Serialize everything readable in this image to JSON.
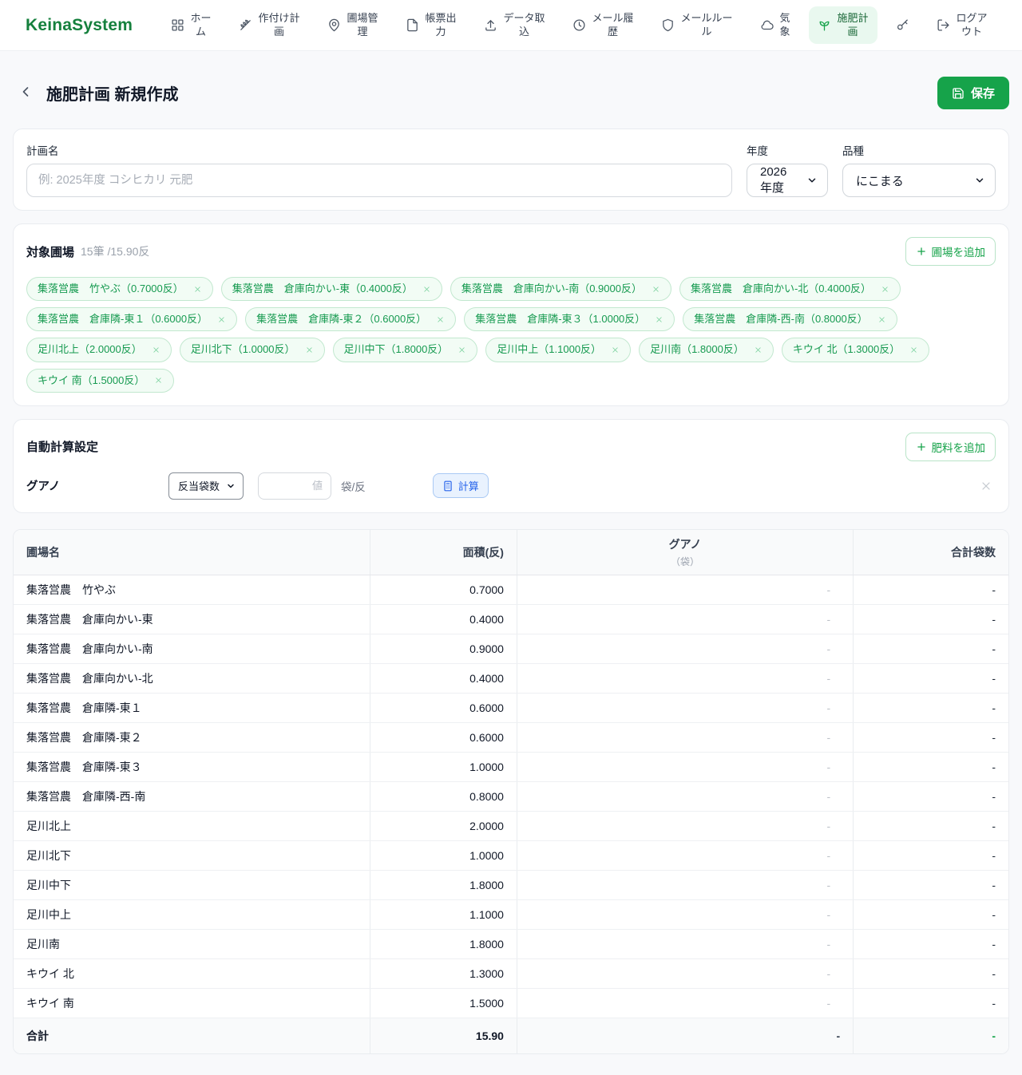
{
  "brand": {
    "name": "KeinaSystem",
    "color": "#15803d"
  },
  "colors": {
    "accent_green": "#16a34a",
    "active_nav_bg": "#e9f8ef",
    "tag_green": "#169a50",
    "calc_blue": "#2563eb"
  },
  "nav": {
    "items": [
      {
        "id": "home",
        "label": "ホーム",
        "icon": "grid-icon",
        "active": false
      },
      {
        "id": "cropping-plan",
        "label": "作付け計画",
        "icon": "wheat-icon",
        "active": false
      },
      {
        "id": "field-management",
        "label": "圃場管理",
        "icon": "map-pin-icon",
        "active": false
      },
      {
        "id": "report-output",
        "label": "帳票出力",
        "icon": "document-icon",
        "active": false
      },
      {
        "id": "data-import",
        "label": "データ取込",
        "icon": "upload-icon",
        "active": false
      },
      {
        "id": "mail-history",
        "label": "メール履歴",
        "icon": "history-icon",
        "active": false
      },
      {
        "id": "mail-rules",
        "label": "メールルール",
        "icon": "shield-icon",
        "active": false
      },
      {
        "id": "weather",
        "label": "気象",
        "icon": "cloud-icon",
        "active": false
      },
      {
        "id": "fertilization-plan",
        "label": "施肥計画",
        "icon": "sprout-icon",
        "active": true
      },
      {
        "id": "key",
        "label": "",
        "icon": "key-icon",
        "active": false
      },
      {
        "id": "logout",
        "label": "ログアウト",
        "icon": "logout-icon",
        "active": false
      }
    ]
  },
  "header": {
    "title": "施肥計画 新規作成",
    "save_label": "保存"
  },
  "plan_form": {
    "name_label": "計画名",
    "name_placeholder": "例: 2025年度 コシヒカリ 元肥",
    "year_label": "年度",
    "year_value": "2026年度",
    "variety_label": "品種",
    "variety_value": "にこまる"
  },
  "fields_section": {
    "title": "対象圃場",
    "summary": "15筆 /15.90反",
    "add_button_label": "圃場を追加",
    "tags": [
      "集落営農　竹やぶ（0.7000反）",
      "集落営農　倉庫向かい-東（0.4000反）",
      "集落営農　倉庫向かい-南（0.9000反）",
      "集落営農　倉庫向かい-北（0.4000反）",
      "集落営農　倉庫隣-東１（0.6000反）",
      "集落営農　倉庫隣-東２（0.6000反）",
      "集落営農　倉庫隣-東３（1.0000反）",
      "集落営農　倉庫隣-西-南（0.8000反）",
      "足川北上（2.0000反）",
      "足川北下（1.0000反）",
      "足川中下（1.8000反）",
      "足川中上（1.1000反）",
      "足川南（1.8000反）",
      "キウイ 北（1.3000反）",
      "キウイ 南（1.5000反）"
    ]
  },
  "calc_section": {
    "title": "自動計算設定",
    "add_button_label": "肥料を追加",
    "fertilizer_name": "グアノ",
    "mode_value": "反当袋数",
    "value_placeholder": "値",
    "unit_label": "袋/反",
    "calc_button_label": "計算"
  },
  "table": {
    "headers": {
      "field": "圃場名",
      "area": "面積(反)",
      "fertilizer": "グアノ",
      "fertilizer_unit": "（袋）",
      "total": "合計袋数"
    },
    "rows": [
      {
        "name": "集落営農　竹やぶ",
        "area": "0.7000",
        "fertilizer": "-",
        "total": "-"
      },
      {
        "name": "集落営農　倉庫向かい-東",
        "area": "0.4000",
        "fertilizer": "-",
        "total": "-"
      },
      {
        "name": "集落営農　倉庫向かい-南",
        "area": "0.9000",
        "fertilizer": "-",
        "total": "-"
      },
      {
        "name": "集落営農　倉庫向かい-北",
        "area": "0.4000",
        "fertilizer": "-",
        "total": "-"
      },
      {
        "name": "集落営農　倉庫隣-東１",
        "area": "0.6000",
        "fertilizer": "-",
        "total": "-"
      },
      {
        "name": "集落営農　倉庫隣-東２",
        "area": "0.6000",
        "fertilizer": "-",
        "total": "-"
      },
      {
        "name": "集落営農　倉庫隣-東３",
        "area": "1.0000",
        "fertilizer": "-",
        "total": "-"
      },
      {
        "name": "集落営農　倉庫隣-西-南",
        "area": "0.8000",
        "fertilizer": "-",
        "total": "-"
      },
      {
        "name": "足川北上",
        "area": "2.0000",
        "fertilizer": "-",
        "total": "-"
      },
      {
        "name": "足川北下",
        "area": "1.0000",
        "fertilizer": "-",
        "total": "-"
      },
      {
        "name": "足川中下",
        "area": "1.8000",
        "fertilizer": "-",
        "total": "-"
      },
      {
        "name": "足川中上",
        "area": "1.1000",
        "fertilizer": "-",
        "total": "-"
      },
      {
        "name": "足川南",
        "area": "1.8000",
        "fertilizer": "-",
        "total": "-"
      },
      {
        "name": "キウイ 北",
        "area": "1.3000",
        "fertilizer": "-",
        "total": "-"
      },
      {
        "name": "キウイ 南",
        "area": "1.5000",
        "fertilizer": "-",
        "total": "-"
      }
    ],
    "footer": {
      "label": "合計",
      "area": "15.90",
      "fertilizer": "-",
      "total": "-"
    }
  }
}
